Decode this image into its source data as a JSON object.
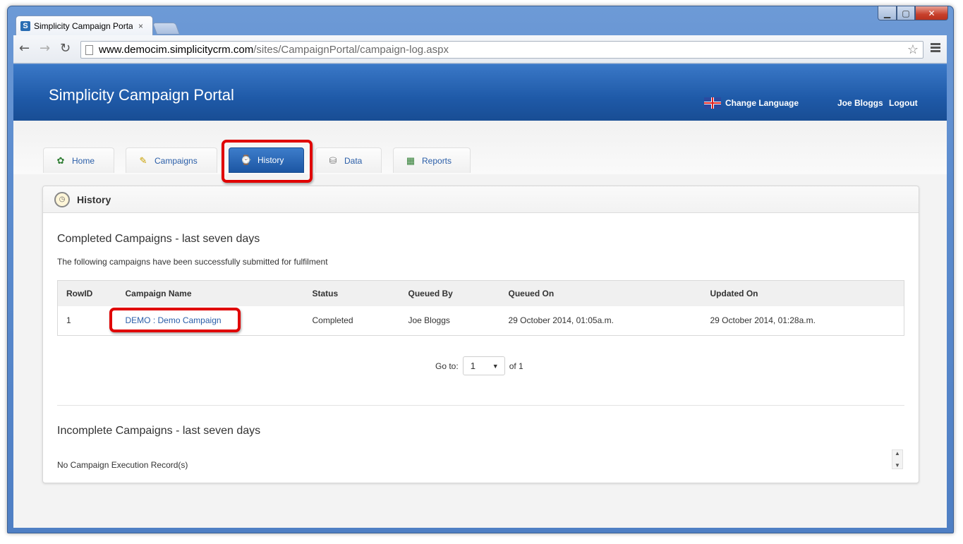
{
  "browser": {
    "tab_title": "Simplicity Campaign Portal",
    "tab_close": "×",
    "url_host": "www.democim.simplicitycrm.com",
    "url_path": "/sites/CampaignPortal/campaign-log.aspx",
    "favicon_letter": "S"
  },
  "header": {
    "brand": "Simplicity Campaign Portal",
    "change_language": "Change Language",
    "user": "Joe Bloggs",
    "logout": "Logout"
  },
  "nav": {
    "tabs": [
      {
        "label": "Home",
        "icon": "home-icon"
      },
      {
        "label": "Campaigns",
        "icon": "pencil-icon"
      },
      {
        "label": "History",
        "icon": "history-icon",
        "active": true
      },
      {
        "label": "Data",
        "icon": "database-icon"
      },
      {
        "label": "Reports",
        "icon": "report-icon"
      }
    ]
  },
  "panel": {
    "title": "History",
    "completed_title": "Completed Campaigns - last seven days",
    "completed_desc": "The following campaigns have been successfully submitted for fulfilment",
    "columns": [
      "RowID",
      "Campaign Name",
      "Status",
      "Queued By",
      "Queued On",
      "Updated On"
    ],
    "rows": [
      {
        "rowid": "1",
        "campaign": "DEMO : Demo Campaign",
        "status": "Completed",
        "queued_by": "Joe Bloggs",
        "queued_on": "29 October 2014, 01:05a.m.",
        "updated_on": "29 October 2014, 01:28a.m."
      }
    ],
    "pager": {
      "goto_label": "Go to:",
      "page": "1",
      "of_label": "of 1"
    },
    "incomplete_title": "Incomplete Campaigns - last seven days",
    "incomplete_empty": "No Campaign Execution Record(s)"
  },
  "colors": {
    "header_blue": "#1f5aa8",
    "link_blue": "#2a5ea8",
    "highlight_red": "#e00000"
  }
}
